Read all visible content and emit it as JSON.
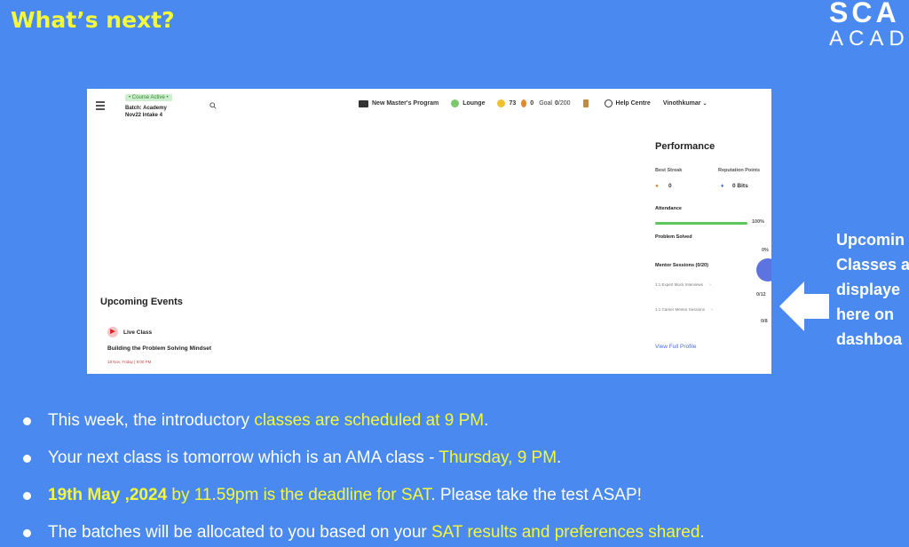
{
  "slide": {
    "title": "What’s next?",
    "brand_line1": "SCA",
    "brand_line2": "ACAD"
  },
  "dashboard": {
    "course_badge": "• Course Active •",
    "batch_line1": "Batch: Academy",
    "batch_line2": "Nov22 Intake 4",
    "nav": {
      "program": "New Master's Program",
      "lounge": "Lounge",
      "coins": "73",
      "streak": "0",
      "goal_label": "Goal",
      "goal_value": "0",
      "goal_total": "/200",
      "help": "Help Centre",
      "user": "Vinothkumar"
    },
    "performance": {
      "title": "Performance",
      "best_streak_label": "Best Streak",
      "best_streak_value": "0",
      "reputation_label": "Reputation Points",
      "reputation_value": "0 Bits",
      "attendance_label": "Attendance",
      "attendance_value": "100%",
      "attendance_fraction": 1.0,
      "problem_solved_label": "Problem Solved",
      "problem_solved_value": "0%",
      "mentor_label": "Mentor Sessions (0/20)",
      "mentor_items": [
        {
          "label": "1:1 Expert Mock Interviews",
          "count": "0/12"
        },
        {
          "label": "1:1 Career Mentor Sessions",
          "count": "0/8"
        }
      ],
      "view_profile": "View Full Profile"
    },
    "events": {
      "title": "Upcoming Events",
      "type": "Live Class",
      "name": "Building the Problem Solving Mindset",
      "date": "18 Nov, Friday | 9:00 PM"
    }
  },
  "side_note": {
    "line1": "Upcomin",
    "line2": "Classes a",
    "line3": "displaye",
    "line4": "here on",
    "line5": "dashboa"
  },
  "bullets": {
    "b1_pre": "This week, the introductory ",
    "b1_hl": "classes are scheduled at 9 PM",
    "b1_post": ".",
    "b2_pre": "Your next class is tomorrow which is an AMA class - ",
    "b2_hl": "Thursday, 9 PM",
    "b2_post": ".",
    "b3_bold": "19th May ,2024",
    "b3_hl": " by 11.59pm is the deadline for SAT",
    "b3_post": ". Please take the test ASAP!",
    "b4_pre": "The batches will be allocated to you based on your ",
    "b4_hl": "SAT results and preferences shared",
    "b4_post": "."
  },
  "colors": {
    "background": "#4a8af0",
    "highlight": "#f4f83a",
    "attendance_bar": "#5cc85c",
    "link": "#4a6fd8"
  }
}
